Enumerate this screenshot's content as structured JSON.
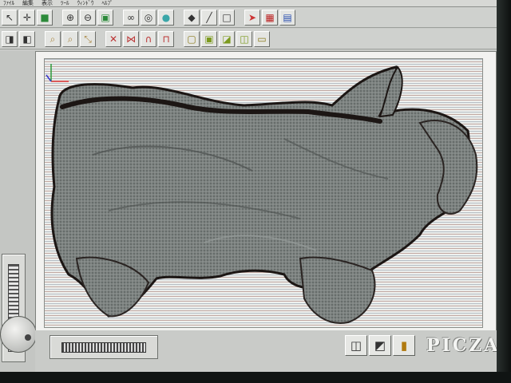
{
  "menu": {
    "items": [
      "ﾌｧｲﾙ",
      "編集",
      "表示",
      "ﾂｰﾙ",
      "ｳｨﾝﾄﾞｳ",
      "ﾍﾙﾌﾟ"
    ]
  },
  "toolbar1": {
    "icons": [
      "cursor-icon",
      "move-icon",
      "cube-icon",
      "zoom-in-icon",
      "zoom-out-icon",
      "fit-view-icon",
      "link-icon",
      "spheres-icon",
      "sphere-icon",
      "paint-icon",
      "line-icon",
      "blank-icon",
      "select-point-icon",
      "grid-icon",
      "save-view-icon"
    ]
  },
  "toolbar2": {
    "icons": [
      "mirror-x-icon",
      "mirror-y-icon",
      "magnify-icon",
      "magnify-region-icon",
      "shrink-icon",
      "flip-horizontal-icon",
      "flip-vertical-icon",
      "arch-icon",
      "frame-icon",
      "box-outline-icon",
      "box-solid-icon",
      "box-corner-icon",
      "box-stack-icon",
      "box-open-icon"
    ]
  },
  "brand": {
    "name": "PICZA"
  },
  "colors": {
    "screen_bg": "#c9cbc8",
    "scan_lines": "#b7bfc6",
    "model_fill": "#7e8482",
    "model_dark": "#1c1614"
  },
  "bottom": {
    "icons": [
      "render-wire-icon",
      "render-solid-icon",
      "exit-door-icon"
    ]
  }
}
